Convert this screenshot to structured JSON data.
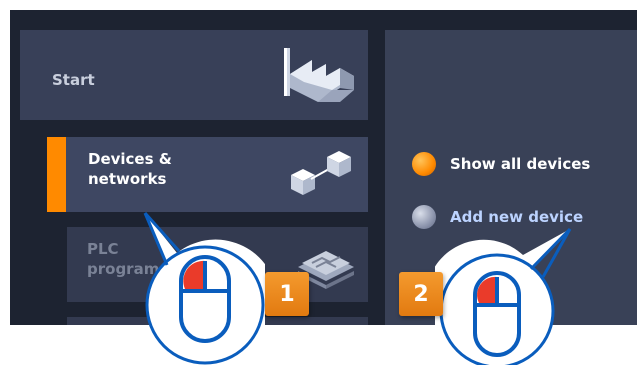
{
  "nav": {
    "start_label": "Start",
    "devices_label_line1": "Devices &",
    "devices_label_line2": "networks",
    "plc_label_line1": "PLC",
    "plc_label_line2": "programming"
  },
  "actions": {
    "show_all_label": "Show all devices",
    "add_new_label": "Add new device"
  },
  "callouts": {
    "step1": "1",
    "step2": "2"
  },
  "colors": {
    "accent": "#ff8a00",
    "background": "#1d2331",
    "tile": "#384058"
  },
  "icons": [
    "factory-icon",
    "devices-network-icon",
    "plc-program-icon",
    "mouse-left-click-icon"
  ]
}
